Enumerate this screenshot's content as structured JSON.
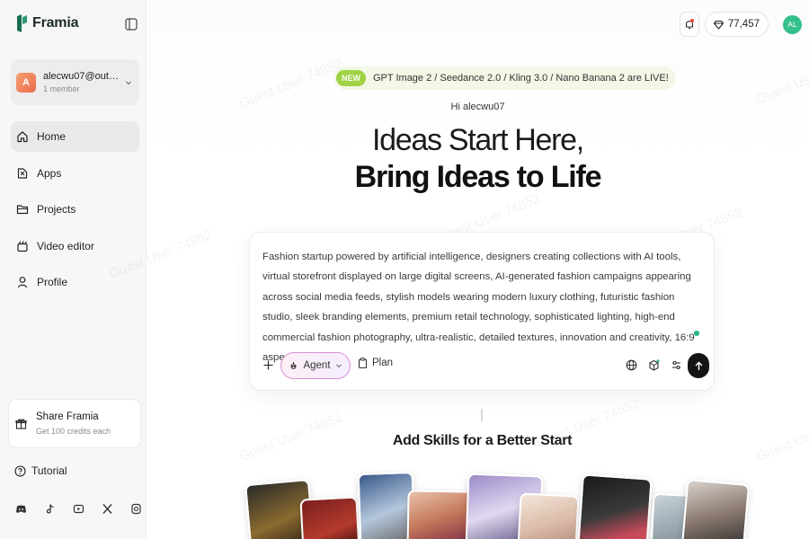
{
  "sidebar": {
    "brand": "Framia",
    "account": {
      "initial": "A",
      "email": "alecwu07@outloo...",
      "members": "1 member"
    },
    "nav": [
      {
        "label": "Home",
        "icon": "home-icon",
        "active": true
      },
      {
        "label": "Apps",
        "icon": "apps-icon",
        "active": false
      },
      {
        "label": "Projects",
        "icon": "folder-icon",
        "active": false
      },
      {
        "label": "Video editor",
        "icon": "video-editor-icon",
        "active": false
      },
      {
        "label": "Profile",
        "icon": "profile-icon",
        "active": false
      }
    ],
    "share": {
      "title": "Share Framia",
      "subtitle": "Get 100 credits each"
    },
    "tutorial": "Tutorial",
    "socials": [
      "discord-icon",
      "tiktok-icon",
      "youtube-icon",
      "x-icon",
      "instagram-icon"
    ]
  },
  "header": {
    "credits": "77,457",
    "user_initials": "AL"
  },
  "announcement": {
    "badge": "NEW",
    "text": "GPT Image 2 / Seedance 2.0 / Kling 3.0 / Nano Banana 2 are LIVE!"
  },
  "hero": {
    "greeting": "Hi alecwu07",
    "line1": "Ideas Start Here,",
    "line2": "Bring Ideas to Life"
  },
  "prompt": {
    "text": "Fashion startup powered by artificial intelligence, designers creating collections with AI tools, virtual storefront displayed on large digital screens, AI-generated fashion campaigns appearing across social media feeds, stylish models wearing modern luxury clothing, futuristic fashion studio, sleek branding elements, premium retail technology, sophisticated lighting, high-end commercial fashion photography, ultra-realistic, detailed textures, innovation and creativity, 16:9 aspect ratio.",
    "agent_label": "Agent",
    "plan_label": "Plan"
  },
  "skills": {
    "title": "Add Skills for a Better Start"
  },
  "watermark": "Guest User 74852",
  "colors": {
    "brand_green": "#1a6b4f",
    "accent_green": "#33c08c",
    "new_badge": "#9fd244",
    "agent_border": "#d991d8"
  }
}
